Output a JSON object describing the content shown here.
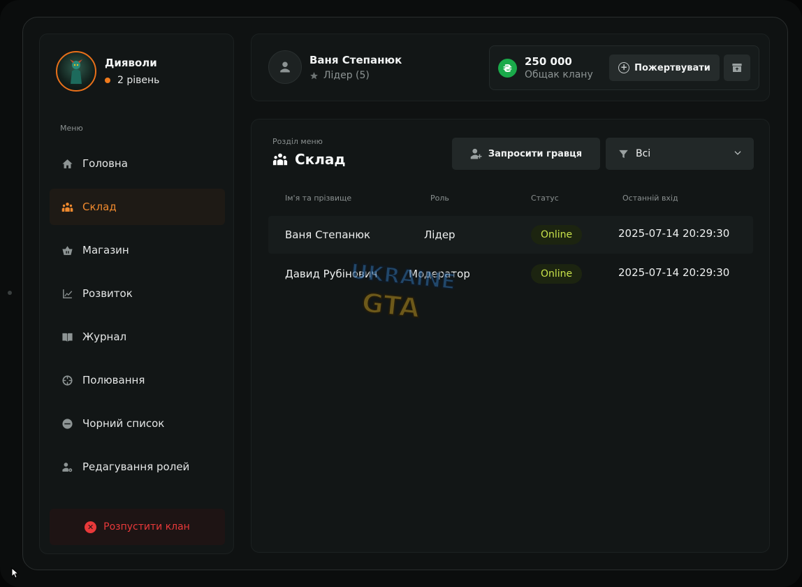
{
  "clan": {
    "name": "Дияволи",
    "level": "2 рівень"
  },
  "sidebar": {
    "caption": "Меню",
    "items": [
      {
        "label": "Головна",
        "icon": "home-icon",
        "active": false
      },
      {
        "label": "Склад",
        "icon": "people-icon",
        "active": true
      },
      {
        "label": "Магазин",
        "icon": "basket-icon",
        "active": false
      },
      {
        "label": "Розвиток",
        "icon": "chart-line-icon",
        "active": false
      },
      {
        "label": "Журнал",
        "icon": "book-icon",
        "active": false
      },
      {
        "label": "Полювання",
        "icon": "crosshair-icon",
        "active": false
      },
      {
        "label": "Чорний список",
        "icon": "minus-circle-icon",
        "active": false
      },
      {
        "label": "Редагування ролей",
        "icon": "user-gear-icon",
        "active": false
      }
    ],
    "disband_label": "Розпустити клан"
  },
  "user": {
    "name": "Ваня Степанюк",
    "role": "Лідер (5)"
  },
  "treasury": {
    "currency_symbol": "₴",
    "amount": "250 000",
    "caption": "Общак клану",
    "donate_label": "Пожертвувати"
  },
  "section": {
    "caption": "Розділ меню",
    "title": "Склад",
    "invite_label": "Запросити гравця",
    "filter_value": "Всі"
  },
  "table": {
    "headers": [
      "Ім'я та прізвище",
      "Роль",
      "Статус",
      "Останній вхід"
    ],
    "rows": [
      {
        "name": "Ваня Степанюк",
        "role": "Лідер",
        "status": "Online",
        "last_login": "2025-07-14 20:29:30"
      },
      {
        "name": "Давид Рубінович",
        "role": "Модератор",
        "status": "Online",
        "last_login": "2025-07-14 20:29:30"
      }
    ]
  },
  "watermark": {
    "line1": "UKRAINE",
    "line2": "GTA"
  },
  "colors": {
    "accent": "#f08a2e",
    "danger": "#e8393a",
    "online": "#c8e24a",
    "coin": "#1aaa4a"
  }
}
